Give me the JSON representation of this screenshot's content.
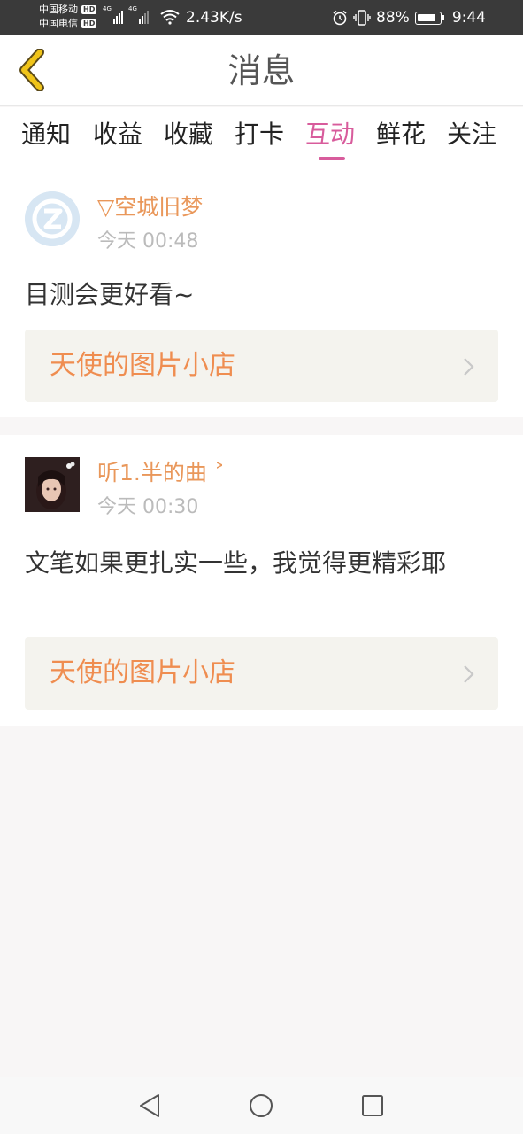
{
  "status_bar": {
    "carrier1": "中国移动",
    "carrier2": "中国电信",
    "hd_badge": "HD",
    "network_type": "4G",
    "net_speed": "2.43K/s",
    "battery": "88%",
    "time": "9:44",
    "icons": [
      "signal-icon",
      "wifi-icon",
      "alarm-icon",
      "vibrate-icon",
      "battery-icon"
    ]
  },
  "header": {
    "title": "消息",
    "back_icon": "chevron-left-icon",
    "back_color": "#f0c419"
  },
  "tabs": [
    {
      "label": "通知",
      "active": false
    },
    {
      "label": "收益",
      "active": false
    },
    {
      "label": "收藏",
      "active": false
    },
    {
      "label": "打卡",
      "active": false
    },
    {
      "label": "互动",
      "active": true
    },
    {
      "label": "鲜花",
      "active": false
    },
    {
      "label": "关注",
      "active": false
    }
  ],
  "messages": [
    {
      "username": "▽空城旧梦",
      "time": "今天 00:48",
      "comment": "目测会更好看~",
      "link": "天使的图片小店",
      "avatar": "qq-default-avatar"
    },
    {
      "username": "听1.半的曲 ˃",
      "time": "今天 00:30",
      "comment": "文笔如果更扎实一些，我觉得更精彩耶",
      "link": "天使的图片小店",
      "avatar": "user-photo-avatar"
    }
  ],
  "nav": {
    "back_icon": "triangle-back-icon",
    "home_icon": "circle-home-icon",
    "recent_icon": "square-recent-icon"
  },
  "colors": {
    "accent": "#d85c9c",
    "username": "#e9975a",
    "link": "#ef8d50"
  }
}
